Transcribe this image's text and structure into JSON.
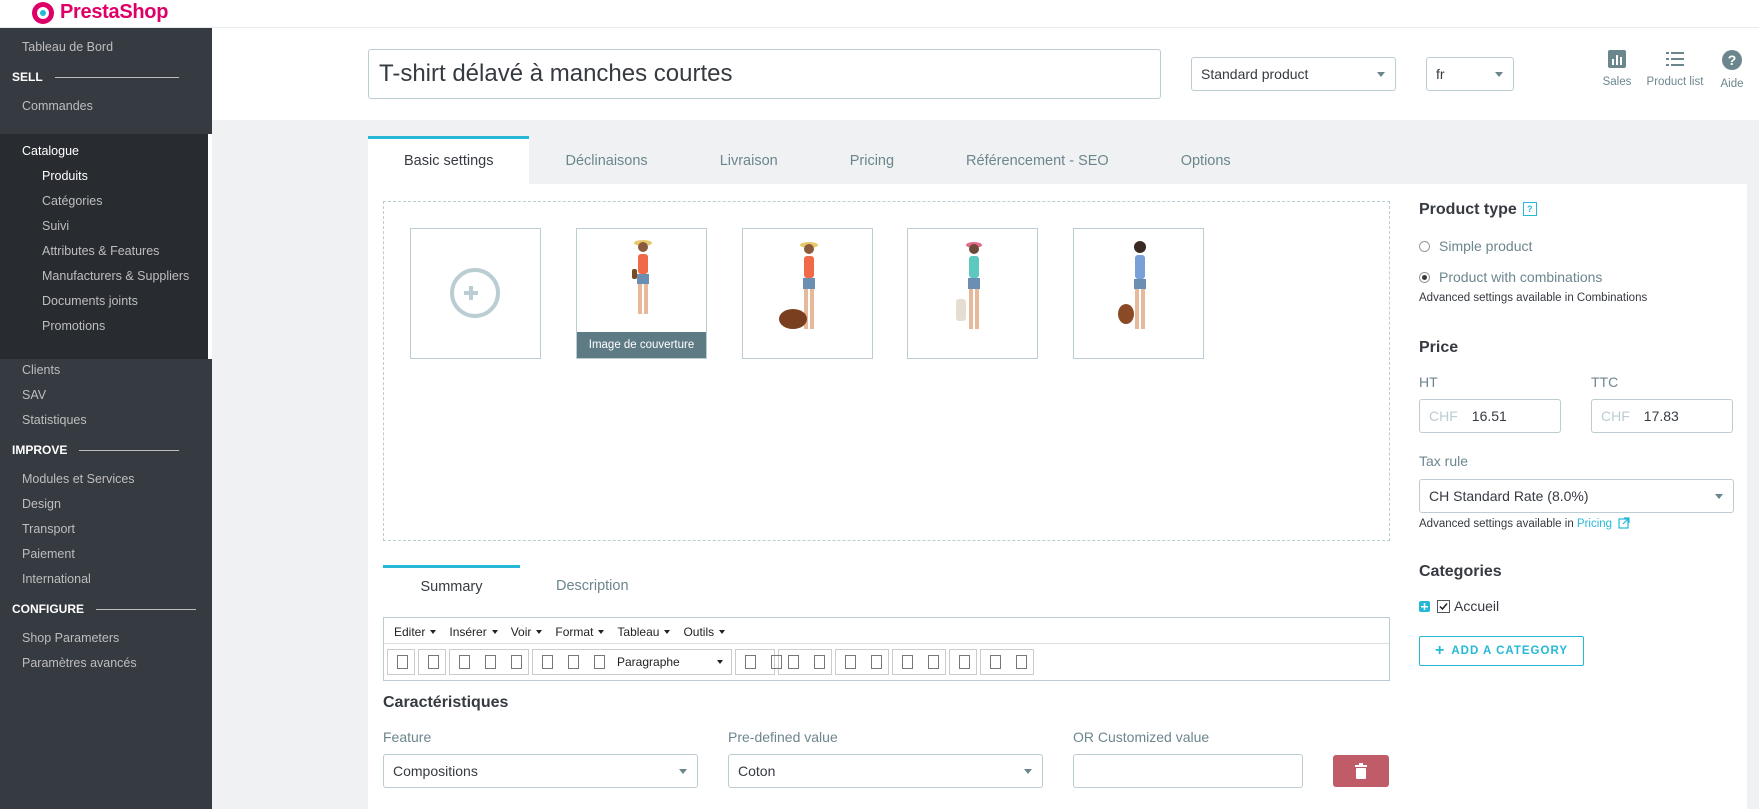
{
  "brand": {
    "name": "PrestaShop"
  },
  "sidebar": {
    "dashboard": "Tableau de Bord",
    "sections": {
      "sell": "SELL",
      "improve": "IMPROVE",
      "configure": "CONFIGURE"
    },
    "sell_items": [
      "Commandes",
      "Catalogue"
    ],
    "catalogue_sub": [
      "Produits",
      "Catégories",
      "Suivi",
      "Attributes & Features",
      "Manufacturers & Suppliers",
      "Documents joints",
      "Promotions"
    ],
    "after_catalogue": [
      "Clients",
      "SAV",
      "Statistiques"
    ],
    "improve_items": [
      "Modules et Services",
      "Design",
      "Transport",
      "Paiement",
      "International"
    ],
    "configure_items": [
      "Shop Parameters",
      "Paramètres avancés"
    ]
  },
  "header": {
    "product_name": "T-shirt délavé à manches courtes",
    "product_type_select": "Standard product",
    "lang_select": "fr",
    "buttons": {
      "sales": "Sales",
      "product_list": "Product list",
      "help": "Aide"
    }
  },
  "tabs": [
    "Basic settings",
    "Déclinaisons",
    "Livraison",
    "Pricing",
    "Référencement - SEO",
    "Options"
  ],
  "images": {
    "cover_label": "Image de couverture"
  },
  "summary_tabs": [
    "Summary",
    "Description"
  ],
  "editor": {
    "menu": [
      "Editer",
      "Insérer",
      "Voir",
      "Format",
      "Tableau",
      "Outils"
    ],
    "block_format": "Paragraphe"
  },
  "features": {
    "title": "Caractéristiques",
    "labels": {
      "feature": "Feature",
      "predefined": "Pre-defined value",
      "custom": "OR Customized value"
    },
    "feature_value": "Compositions",
    "predefined_value": "Coton",
    "custom_value": ""
  },
  "right": {
    "product_type_title": "Product type",
    "help_badge": "?",
    "simple": "Simple product",
    "combinations": "Product with combinations",
    "combinations_note": "Advanced settings available in Combinations",
    "price_title": "Price",
    "ht_label": "HT",
    "ttc_label": "TTC",
    "currency": "CHF",
    "price_ht": "16.51",
    "price_ttc": "17.83",
    "tax_rule_label": "Tax rule",
    "tax_rule_value": "CH Standard Rate (8.0%)",
    "tax_note_prefix": "Advanced settings available in",
    "tax_note_link": "Pricing",
    "categories_title": "Categories",
    "category_checked": "Accueil",
    "add_category": "ADD A CATEGORY"
  },
  "colors": {
    "accent": "#25b9d7",
    "brand": "#df0067",
    "sidebar": "#363a41",
    "danger": "#c05c67"
  }
}
